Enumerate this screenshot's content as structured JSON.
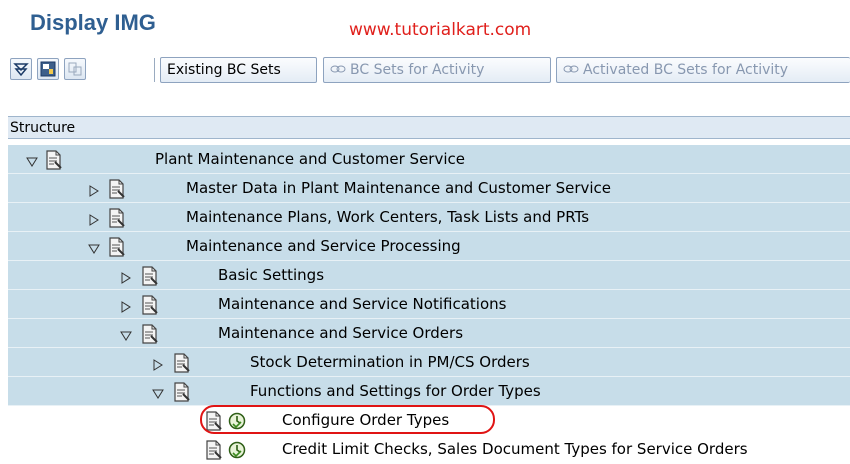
{
  "page": {
    "title": "Display IMG",
    "watermark": "www.tutorialkart.com"
  },
  "toolbar": {
    "icons": [
      "expand-all-icon",
      "find-icon",
      "disabled-icon"
    ],
    "existing_bc_sets": "Existing BC Sets",
    "bc_sets_for_activity": "BC Sets for Activity",
    "activated_bc_sets_for_activity": "Activated BC Sets for Activity"
  },
  "tree": {
    "header": "Structure",
    "nodes": [
      {
        "label": "Plant Maintenance and Customer Service",
        "toggle": "expanded",
        "highlight": true
      },
      {
        "label": "Master Data in Plant Maintenance and Customer Service",
        "toggle": "collapsed",
        "highlight": true
      },
      {
        "label": "Maintenance Plans, Work Centers, Task Lists and PRTs",
        "toggle": "collapsed",
        "highlight": true
      },
      {
        "label": "Maintenance and Service Processing",
        "toggle": "expanded",
        "highlight": true
      },
      {
        "label": "Basic Settings",
        "toggle": "collapsed",
        "highlight": true
      },
      {
        "label": "Maintenance and Service Notifications",
        "toggle": "collapsed",
        "highlight": true
      },
      {
        "label": "Maintenance and Service Orders",
        "toggle": "expanded",
        "highlight": true
      },
      {
        "label": "Stock Determination in PM/CS Orders",
        "toggle": "collapsed",
        "highlight": true
      },
      {
        "label": "Functions and Settings for Order Types",
        "toggle": "expanded",
        "highlight": true
      },
      {
        "label": "Configure Order Types",
        "toggle": "none",
        "activity": true,
        "circled": true,
        "highlight": false
      },
      {
        "label": "Credit Limit Checks, Sales Document Types for Service Orders",
        "toggle": "none",
        "activity": true,
        "highlight": false
      }
    ]
  },
  "colors": {
    "title": "#2f5f91",
    "watermark": "#e0201c",
    "row_highlight": "#c7dde9",
    "header_bg": "#dfe9f3",
    "callout": "#e01414"
  }
}
